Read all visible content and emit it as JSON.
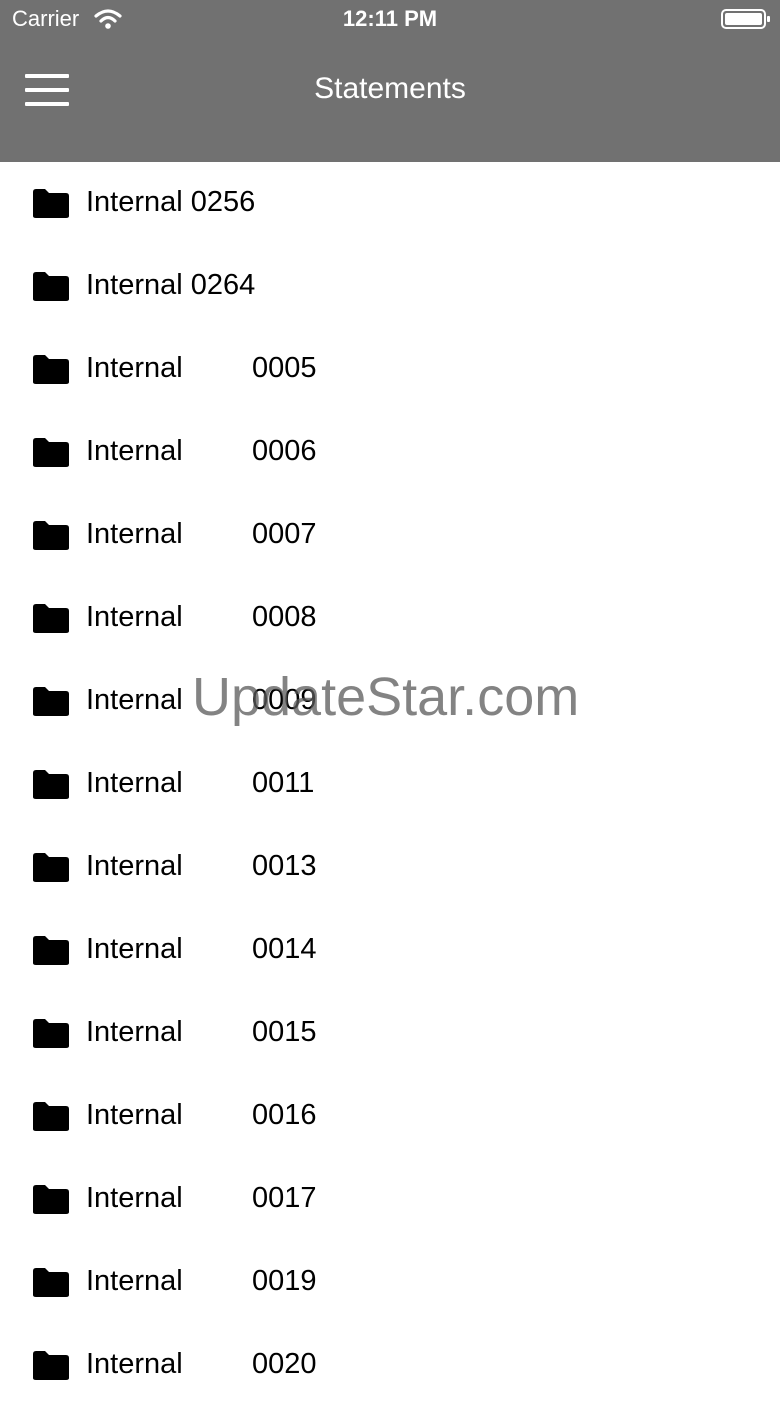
{
  "status_bar": {
    "carrier": "Carrier",
    "time": "12:11 PM"
  },
  "nav": {
    "title": "Statements",
    "menu_icon": "hamburger-menu-icon"
  },
  "colors": {
    "nav_background": "#717171",
    "text": "#000000"
  },
  "folders": [
    {
      "label": "Internal 0256"
    },
    {
      "label": "Internal 0264"
    },
    {
      "name": "Internal",
      "number": "0005"
    },
    {
      "name": "Internal",
      "number": "0006"
    },
    {
      "name": "Internal",
      "number": "0007"
    },
    {
      "name": "Internal",
      "number": "0008"
    },
    {
      "name": "Internal",
      "number": "0009"
    },
    {
      "name": "Internal",
      "number": "0011"
    },
    {
      "name": "Internal",
      "number": "0013"
    },
    {
      "name": "Internal",
      "number": "0014"
    },
    {
      "name": "Internal",
      "number": "0015"
    },
    {
      "name": "Internal",
      "number": "0016"
    },
    {
      "name": "Internal",
      "number": "0017"
    },
    {
      "name": "Internal",
      "number": "0019"
    },
    {
      "name": "Internal",
      "number": "0020"
    }
  ],
  "watermark": "UpdateStar.com"
}
